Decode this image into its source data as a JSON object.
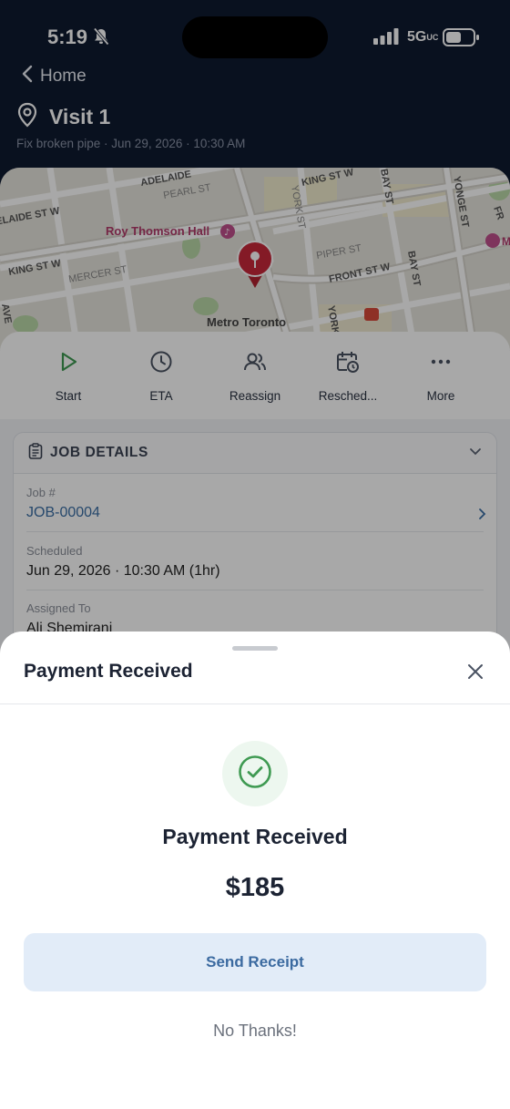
{
  "status_bar": {
    "time": "5:19",
    "network": "5G",
    "network_suffix": "UC"
  },
  "header": {
    "back_label": "Home",
    "title": "Visit 1",
    "subtitle": "Fix broken pipe · Jun 29, 2026 · 10:30 AM"
  },
  "map": {
    "labels": {
      "adelaide": "ADELAIDE",
      "adelaide_w": "ELAIDE ST W",
      "king_w_left": "KING ST W",
      "king_w_top": "KING ST W",
      "pearl": "PEARL ST",
      "mercer": "MERCER ST",
      "york": "YORK ST",
      "york_bottom": "YORK",
      "piper": "PIPER ST",
      "front": "FRONT ST W",
      "bay": "BAY ST",
      "bay_2": "BAY ST",
      "yonge": "YONGE ST",
      "roy_thomson": "Roy Thomson Hall",
      "metro_toronto": "Metro Toronto",
      "fr": "FR",
      "m": "M",
      "ave": "AVE"
    }
  },
  "actions": [
    {
      "label": "Start",
      "icon": "play-icon"
    },
    {
      "label": "ETA",
      "icon": "clock-icon"
    },
    {
      "label": "Reassign",
      "icon": "users-icon"
    },
    {
      "label": "Resched...",
      "icon": "calendar-clock-icon"
    },
    {
      "label": "More",
      "icon": "more-icon"
    }
  ],
  "job_details": {
    "heading": "JOB DETAILS",
    "job_label": "Job #",
    "job_value": "JOB-00004",
    "scheduled_label": "Scheduled",
    "scheduled_value": "Jun 29, 2026 · 10:30 AM (1hr)",
    "assigned_label": "Assigned To",
    "assigned_value": "Ali Shemirani"
  },
  "sheet": {
    "title": "Payment Received",
    "heading": "Payment Received",
    "amount": "$185",
    "send_receipt": "Send Receipt",
    "no_thanks": "No Thanks!"
  },
  "colors": {
    "header_bg": "#0f1a30",
    "accent_green": "#3f9a52",
    "link_blue": "#3a6ea5",
    "button_bg": "#e2ecf8",
    "pin_red": "#c8283a"
  }
}
